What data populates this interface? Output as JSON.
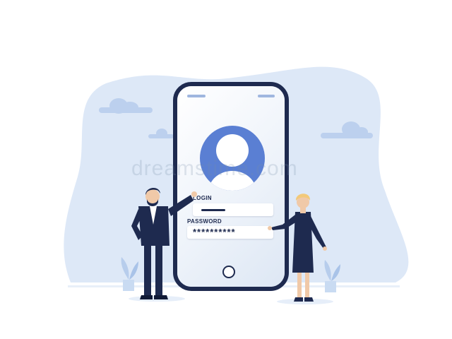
{
  "login_form": {
    "login_label": "LOGIN",
    "password_label": "PASSWORD",
    "password_masked": "**********"
  },
  "watermark": "dreamstime.com",
  "colors": {
    "phone_frame": "#1e2a4f",
    "avatar": "#5a7fd3",
    "background_blob": "#dde8f7",
    "cloud": "#bcd0ee",
    "plant": "#c9dbf2"
  },
  "illustration": {
    "characters": [
      "man-in-suit",
      "woman-in-dress"
    ],
    "icons": [
      "user-avatar-icon",
      "cloud-icon",
      "plant-icon"
    ]
  }
}
